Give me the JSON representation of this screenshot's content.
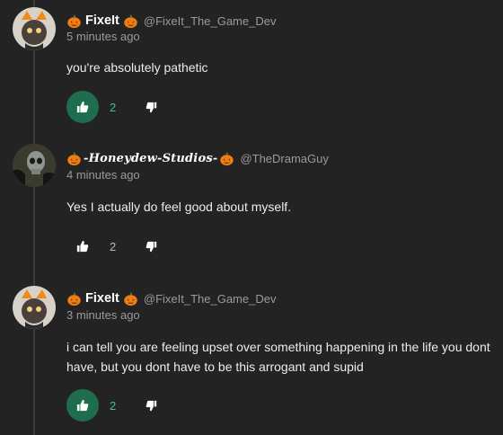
{
  "comments": [
    {
      "username": "FixeIt",
      "handle": "@FixeIt_The_Game_Dev",
      "time": "5 minutes ago",
      "text": "you're absolutely pathetic",
      "likes": "2",
      "liked": true,
      "avatar_icon": "cat-avatar",
      "badge_icon": "pumpkin-icon"
    },
    {
      "username": "-Honeydew-Studios-",
      "handle": "@TheDramaGuy",
      "time": "4 minutes ago",
      "text": "Yes I actually do feel good about myself.",
      "likes": "2",
      "liked": false,
      "avatar_icon": "skull-avatar",
      "badge_icon": "pumpkin-icon"
    },
    {
      "username": "FixeIt",
      "handle": "@FixeIt_The_Game_Dev",
      "time": "3 minutes ago",
      "text": "i can tell you are feeling upset over something happening in the life you dont have, but you dont have to be this arrogant and supid",
      "likes": "2",
      "liked": true,
      "avatar_icon": "cat-avatar",
      "badge_icon": "pumpkin-icon"
    }
  ],
  "colors": {
    "background": "#232323",
    "accent_green": "#1f6d4f",
    "count_green": "#3cc68a",
    "pumpkin_orange": "#ef7d13"
  },
  "icons": {
    "like": "thumbs-up-icon",
    "dislike": "thumbs-down-icon"
  }
}
